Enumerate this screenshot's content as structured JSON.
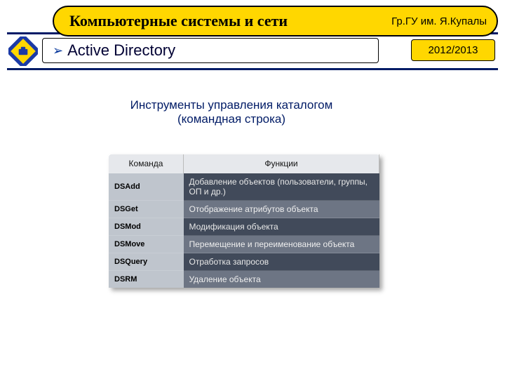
{
  "header": {
    "main_title": "Компьютерные системы и сети",
    "institution": "Гр.ГУ им. Я.Купалы"
  },
  "subheader": {
    "marker": "➢",
    "title": "Active Directory",
    "year": "2012/2013"
  },
  "section_title": "Инструменты управления каталогом\n(командная строка)",
  "table": {
    "headers": {
      "cmd": "Команда",
      "func": "Функции"
    },
    "rows": [
      {
        "cmd": "DSAdd",
        "func": "Добавление объектов (пользователи, группы, ОП и др.)"
      },
      {
        "cmd": "DSGet",
        "func": "Отображение атрибутов объекта"
      },
      {
        "cmd": "DSMod",
        "func": "Модификация объекта"
      },
      {
        "cmd": "DSMove",
        "func": "Перемещение и переименование объекта"
      },
      {
        "cmd": "DSQuery",
        "func": "Отработка запросов"
      },
      {
        "cmd": "DSRM",
        "func": "Удаление объекта"
      }
    ]
  }
}
